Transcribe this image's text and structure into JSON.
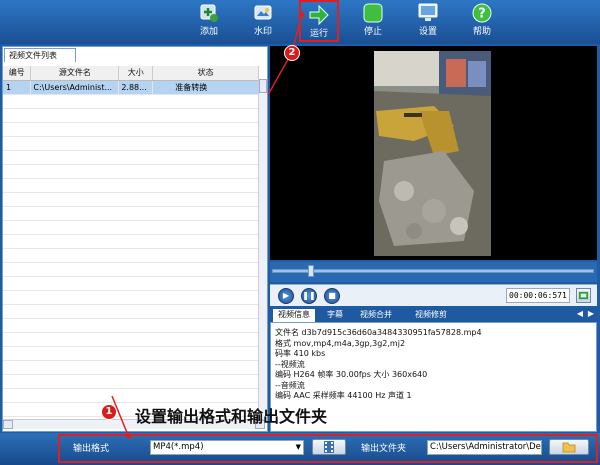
{
  "toolbar": {
    "add": "添加",
    "watermark": "水印",
    "run": "运行",
    "stop": "停止",
    "settings": "设置",
    "help": "帮助"
  },
  "file_list": {
    "tab_label": "视频文件列表",
    "columns": [
      "编号",
      "源文件名",
      "大小",
      "状态"
    ],
    "rows": [
      {
        "num": "1",
        "name": "C:\\Users\\Administ...",
        "size": "2.88...",
        "status": "准备转换"
      }
    ]
  },
  "player": {
    "time": "00:00:06:571"
  },
  "info_tabs": [
    "视频信息",
    "字幕",
    "视频合并",
    "视频修剪"
  ],
  "video_info": {
    "lines": [
      "文件名  d3b7d915c36d60a3484330951fa57828.mp4",
      "格式  mov,mp4,m4a,3gp,3g2,mj2",
      "码率  410 kbs",
      "--视频流",
      "编码  H264   帧率  30.00fps   大小  360x640",
      "--音频流",
      "编码  AAC   采样频率  44100 Hz   声道  1"
    ]
  },
  "bottom": {
    "format_label": "输出格式",
    "format_value": "MP4(*.mp4)",
    "folder_label": "输出文件夹",
    "folder_value": "C:\\Users\\Administrator\\Des"
  },
  "annotations": {
    "marker1": "1",
    "marker2": "2",
    "text": "设置输出格式和输出文件夹"
  },
  "colors": {
    "accent": "#1b5da7",
    "highlight": "#e02020"
  }
}
